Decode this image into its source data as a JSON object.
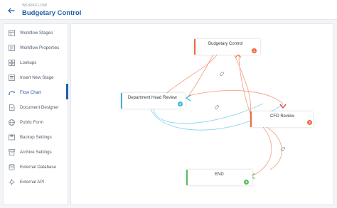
{
  "header": {
    "breadcrumb": "WORKFLOW",
    "title": "Budgetary Control"
  },
  "sidebar": {
    "items": [
      {
        "label": "Workflow Stages",
        "icon": "stages-icon"
      },
      {
        "label": "Workflow Properties",
        "icon": "properties-icon"
      },
      {
        "label": "Lookups",
        "icon": "lookups-icon"
      },
      {
        "label": "Insert New Stage",
        "icon": "insert-stage-icon"
      },
      {
        "label": "Flow Chart",
        "icon": "flow-chart-icon",
        "active": true
      },
      {
        "label": "Document Designer",
        "icon": "document-icon"
      },
      {
        "label": "Public Form",
        "icon": "public-form-icon"
      },
      {
        "label": "Backup Settings",
        "icon": "backup-icon"
      },
      {
        "label": "Archive Settings",
        "icon": "archive-icon"
      },
      {
        "label": "External Database",
        "icon": "database-icon"
      },
      {
        "label": "External API",
        "icon": "api-icon"
      }
    ]
  },
  "flowchart": {
    "nodes": [
      {
        "label": "Budgetary Control",
        "badge": "1",
        "color": "#f0673d"
      },
      {
        "label": "Department Head Review",
        "badge": "2",
        "color": "#3fb6d8"
      },
      {
        "label": "CFO Review",
        "badge": "3",
        "color": "#f0673d"
      },
      {
        "label": "END",
        "badge": "4",
        "color": "#5cbd5c"
      }
    ]
  },
  "colors": {
    "accent": "#1f5fa8",
    "orange": "#f0673d",
    "cyan": "#3fb6d8",
    "green": "#5cbd5c"
  }
}
